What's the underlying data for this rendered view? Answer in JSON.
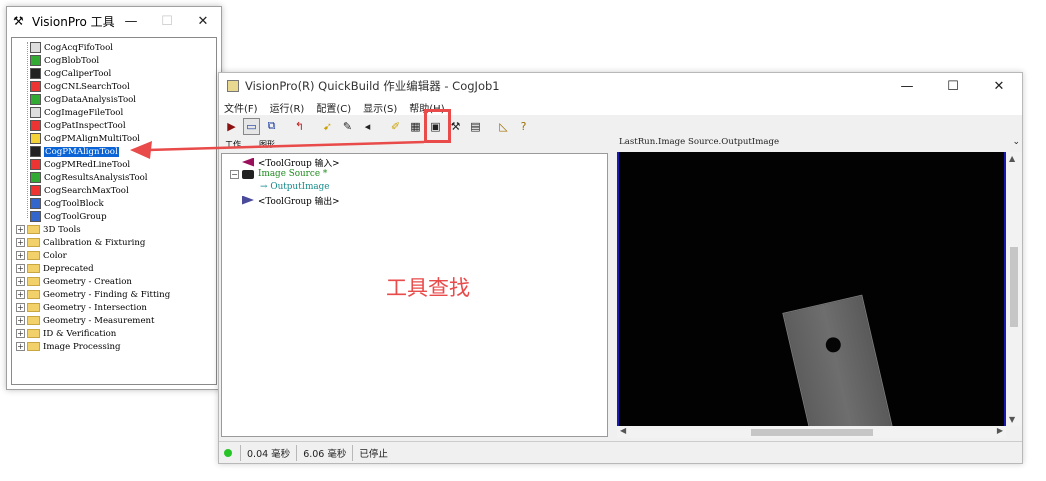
{
  "tools_window": {
    "title": "VisionPro 工具",
    "controls": {
      "minimize": "—",
      "maximize": "☐",
      "close": "✕"
    },
    "tools": [
      {
        "label": "CogAcqFifoTool",
        "icon": "acq-fifo-icon"
      },
      {
        "label": "CogBlobTool",
        "icon": "blob-icon"
      },
      {
        "label": "CogCaliperTool",
        "icon": "caliper-icon"
      },
      {
        "label": "CogCNLSearchTool",
        "icon": "cnl-search-icon"
      },
      {
        "label": "CogDataAnalysisTool",
        "icon": "data-analysis-icon"
      },
      {
        "label": "CogImageFileTool",
        "icon": "image-file-icon"
      },
      {
        "label": "CogPatInspectTool",
        "icon": "pat-inspect-icon"
      },
      {
        "label": "CogPMAlignMultiTool",
        "icon": "pmalign-multi-icon"
      },
      {
        "label": "CogPMAlignTool",
        "icon": "pmalign-icon",
        "selected": true
      },
      {
        "label": "CogPMRedLineTool",
        "icon": "pm-redline-icon"
      },
      {
        "label": "CogResultsAnalysisTool",
        "icon": "results-analysis-icon"
      },
      {
        "label": "CogSearchMaxTool",
        "icon": "search-max-icon"
      },
      {
        "label": "CogToolBlock",
        "icon": "tool-block-icon"
      },
      {
        "label": "CogToolGroup",
        "icon": "tool-group-icon"
      }
    ],
    "folders": [
      "3D Tools",
      "Calibration & Fixturing",
      "Color",
      "Deprecated",
      "Geometry - Creation",
      "Geometry - Finding & Fitting",
      "Geometry - Intersection",
      "Geometry - Measurement",
      "ID & Verification",
      "Image Processing"
    ]
  },
  "qb_window": {
    "title": "VisionPro(R) QuickBuild 作业编辑器 - CogJob1",
    "controls": {
      "minimize": "—",
      "maximize": "☐",
      "close": "✕"
    },
    "menu": [
      "文件(F)",
      "运行(R)",
      "配置(C)",
      "显示(S)",
      "帮助(H)"
    ],
    "toolbar_icons": [
      "run-icon",
      "image-icon",
      "copy-icon",
      "undo-icon",
      "wand-icon",
      "brush-icon",
      "pin-icon",
      "edit-icon",
      "grid-icon",
      "record-icon",
      "tools-icon",
      "report-icon",
      "measure-icon",
      "help-icon"
    ],
    "tabs": [
      "工作",
      "图形"
    ],
    "job_tree": [
      {
        "label": "<ToolGroup 输入>",
        "color": "#000000"
      },
      {
        "label": "Image Source *",
        "color": "#1b8a1b"
      },
      {
        "label": "OutputImage",
        "color": "#138a8a"
      },
      {
        "label": "<ToolGroup 输出>",
        "color": "#000000"
      }
    ],
    "image_pane_header": "LastRun.Image Source.OutputImage",
    "status": {
      "time1": "0.04 毫秒",
      "time2": "6.06 毫秒",
      "state": "已停止"
    }
  },
  "annotation": {
    "callout_text": "工具查找",
    "accent_color": "#e94a4a"
  }
}
